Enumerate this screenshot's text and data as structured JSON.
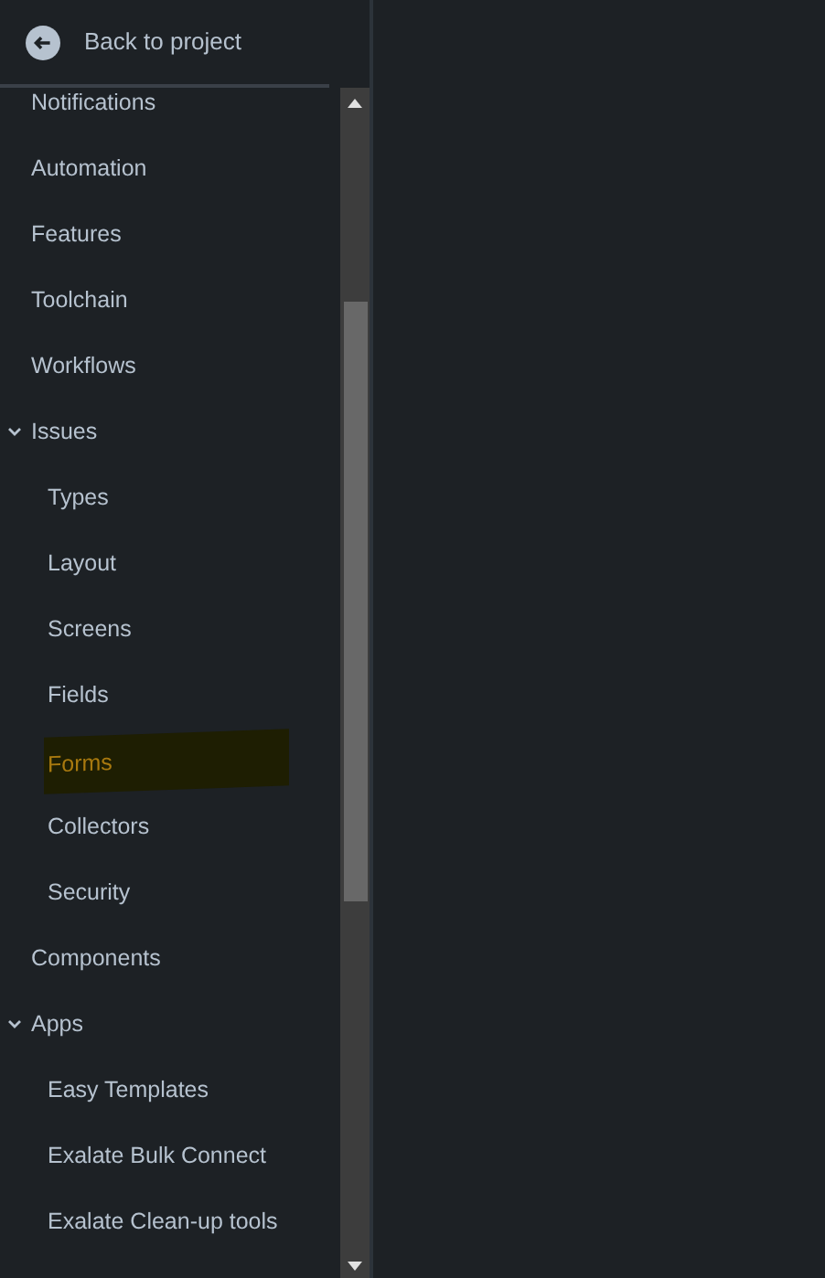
{
  "back_link": {
    "label": "Back to project"
  },
  "nav": [
    {
      "label": "Notifications",
      "selected": false
    },
    {
      "label": "Automation",
      "selected": false
    },
    {
      "label": "Features",
      "selected": false
    },
    {
      "label": "Toolchain",
      "selected": false
    },
    {
      "label": "Workflows",
      "selected": false
    },
    {
      "label": "Issues",
      "expanded": true,
      "selected": false,
      "children": [
        {
          "label": "Types",
          "selected": false
        },
        {
          "label": "Layout",
          "selected": false
        },
        {
          "label": "Screens",
          "selected": false
        },
        {
          "label": "Fields",
          "selected": false
        },
        {
          "label": "Forms",
          "selected": true
        },
        {
          "label": "Collectors",
          "selected": false
        },
        {
          "label": "Security",
          "selected": false
        }
      ]
    },
    {
      "label": "Components",
      "selected": false
    },
    {
      "label": "Apps",
      "expanded": true,
      "selected": false,
      "children": [
        {
          "label": "Easy Templates",
          "selected": false
        },
        {
          "label": "Exalate Bulk Connect",
          "selected": false
        },
        {
          "label": "Exalate Clean-up tools",
          "selected": false
        }
      ]
    }
  ]
}
